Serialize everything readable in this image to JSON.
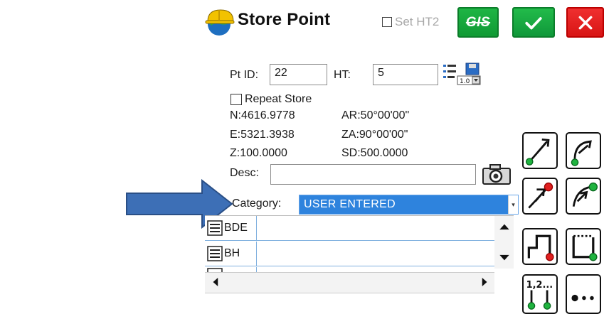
{
  "header": {
    "title": "Store Point",
    "set_ht2_label": "Set HT2",
    "gis_label": "GIS"
  },
  "form": {
    "pt_id_label": "Pt ID:",
    "pt_id_value": "22",
    "ht_label": "HT:",
    "ht_value": "5",
    "repeat_store_label": "Repeat Store",
    "n": "N:4616.9778",
    "e": "E:5321.3938",
    "z": "Z:100.0000",
    "ar": "AR:50°00'00\"",
    "za": "ZA:90°00'00\"",
    "sd": "SD:500.0000",
    "desc_label": "Desc:",
    "desc_value": "",
    "category_label": "Category:",
    "category_value": "USER ENTERED"
  },
  "code_list": {
    "rows": [
      {
        "code": "BDE"
      },
      {
        "code": "BH"
      }
    ]
  },
  "icons": {
    "app": "hardhat-globe-icon",
    "point-tools": "point-list-save-icon",
    "camera": "camera-icon",
    "arrow": "pointer-arrow"
  },
  "colors": {
    "accent_green": "#16a83c",
    "cancel_red": "#e01a1a",
    "selection_blue": "#2e83dd",
    "arrow_blue": "#3d6fb6"
  }
}
